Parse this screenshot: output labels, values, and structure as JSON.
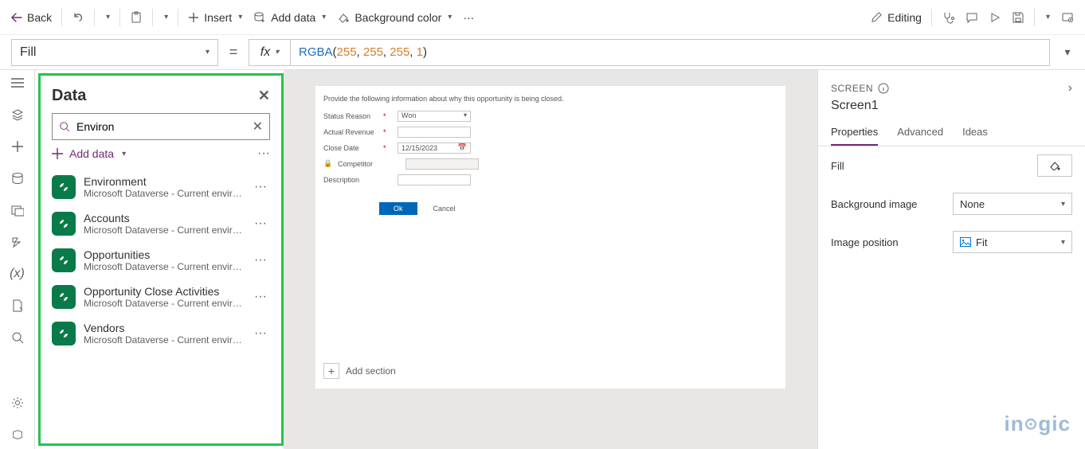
{
  "toolbar": {
    "back": "Back",
    "insert": "Insert",
    "add_data": "Add data",
    "bg_color": "Background color",
    "editing": "Editing"
  },
  "fx": {
    "property": "Fill",
    "fn": "RGBA",
    "a1": "255",
    "a2": "255",
    "a3": "255",
    "a4": "1"
  },
  "data_panel": {
    "title": "Data",
    "search_value": "Environ",
    "add_label": "Add data",
    "items": [
      {
        "name": "Environment",
        "sub": "Microsoft Dataverse - Current environm..."
      },
      {
        "name": "Accounts",
        "sub": "Microsoft Dataverse - Current environm..."
      },
      {
        "name": "Opportunities",
        "sub": "Microsoft Dataverse - Current environm..."
      },
      {
        "name": "Opportunity Close Activities",
        "sub": "Microsoft Dataverse - Current environm..."
      },
      {
        "name": "Vendors",
        "sub": "Microsoft Dataverse - Current environm..."
      }
    ]
  },
  "canvas": {
    "heading": "Provide the following information about why this opportunity is being closed.",
    "rows": {
      "status_reason": "Status Reason",
      "status_reason_val": "Won",
      "actual_revenue": "Actual Revenue",
      "close_date": "Close Date",
      "close_date_val": "12/15/2023",
      "competitor": "Competitor",
      "description": "Description"
    },
    "ok": "Ok",
    "cancel": "Cancel",
    "add_section": "Add section"
  },
  "props": {
    "screen_label": "SCREEN",
    "screen_name": "Screen1",
    "tabs": {
      "p": "Properties",
      "a": "Advanced",
      "i": "Ideas"
    },
    "rows": {
      "fill": "Fill",
      "bg_img": "Background image",
      "bg_img_val": "None",
      "img_pos": "Image position",
      "img_pos_val": "Fit"
    },
    "watermark": "inogic"
  }
}
